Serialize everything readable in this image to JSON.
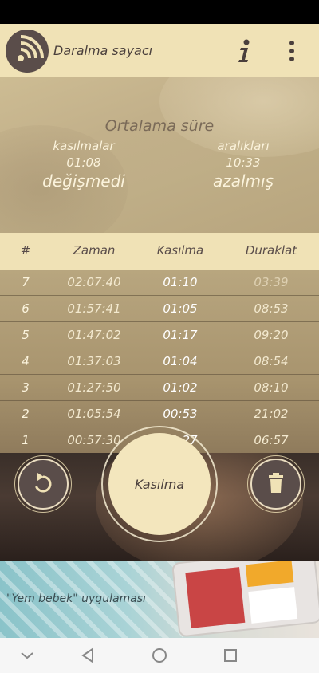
{
  "app_bar": {
    "title": "Daralma sayacı",
    "logo_icon": "signal-waves-icon",
    "info_icon": "info-icon",
    "more_icon": "more-vert-icon"
  },
  "summary": {
    "title": "Ortalama süre",
    "contractions_label": "kasılmalar",
    "intervals_label": "aralıkları",
    "contractions_value": "01:08",
    "intervals_value": "10:33",
    "contractions_trend": "değişmedi",
    "intervals_trend": "azalmış"
  },
  "table": {
    "headers": [
      "#",
      "Zaman",
      "Kasılma",
      "Duraklat"
    ],
    "rows": [
      {
        "num": "7",
        "time": "02:07:40",
        "duration": "01:10",
        "pause": "03:39"
      },
      {
        "num": "6",
        "time": "01:57:41",
        "duration": "01:05",
        "pause": "08:53"
      },
      {
        "num": "5",
        "time": "01:47:02",
        "duration": "01:17",
        "pause": "09:20"
      },
      {
        "num": "4",
        "time": "01:37:03",
        "duration": "01:04",
        "pause": "08:54"
      },
      {
        "num": "3",
        "time": "01:27:50",
        "duration": "01:02",
        "pause": "08:10"
      },
      {
        "num": "2",
        "time": "01:05:54",
        "duration": "00:53",
        "pause": "21:02"
      },
      {
        "num": "1",
        "time": "00:57:30",
        "duration": "01:27",
        "pause": "06:57"
      }
    ]
  },
  "controls": {
    "undo_icon": "undo-icon",
    "delete_icon": "trash-icon",
    "main_label": "Kasılma"
  },
  "ad": {
    "text": "\"Yem bebek\" uygulaması"
  },
  "colors": {
    "accent_cream": "#f0e2b6",
    "dark_brown": "#5a4d4a"
  }
}
